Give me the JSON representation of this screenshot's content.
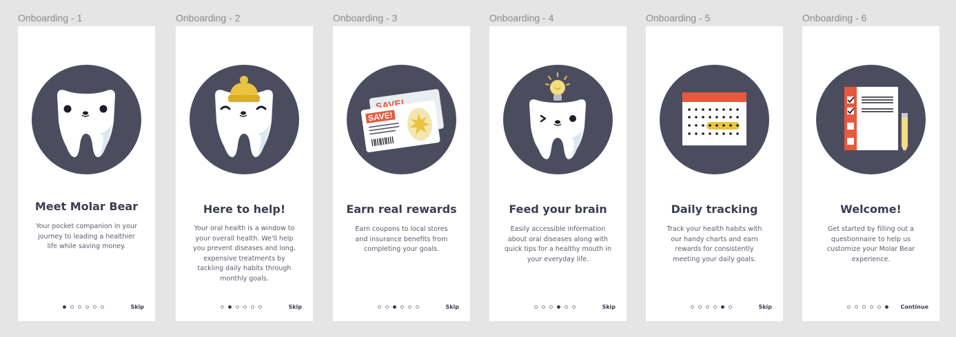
{
  "screens": [
    {
      "frame_label": "Onboarding - 1",
      "title": "Meet Molar Bear",
      "description": "Your pocket companion in your journey to leading a healthier life while saving money.",
      "active_dot": 1,
      "action_label": "Skip",
      "illustration": "molar-bear-icon"
    },
    {
      "frame_label": "Onboarding - 2",
      "title": "Here to help!",
      "description": "Your oral health is a window to your overall health. We'll help you prevent diseases and long, expensive treatments by tackling daily habits through monthly goals.",
      "active_dot": 2,
      "action_label": "Skip",
      "illustration": "molar-bear-beanie-icon"
    },
    {
      "frame_label": "Onboarding - 3",
      "title": "Earn real rewards",
      "description": "Earn coupons to local stores and insurance benefits from completing your goals.",
      "active_dot": 3,
      "action_label": "Skip",
      "illustration": "coupon-cards-icon",
      "coupon_text": "SAVE!"
    },
    {
      "frame_label": "Onboarding - 4",
      "title": "Feed your brain",
      "description": "Easily accessible information about oral diseases along with quick tips for a healthy mouth in your everyday life.",
      "active_dot": 4,
      "action_label": "Skip",
      "illustration": "molar-bear-lightbulb-icon"
    },
    {
      "frame_label": "Onboarding - 5",
      "title": "Daily tracking",
      "description": "Track your health habits with our handy charts and earn rewards for consistently meeting your daily goals.",
      "active_dot": 5,
      "action_label": "Skip",
      "illustration": "calendar-icon"
    },
    {
      "frame_label": "Onboarding - 6",
      "title": "Welcome!",
      "description": "Get started by filling out a questionnaire to help us customize your Molar Bear experience.",
      "active_dot": 6,
      "action_label": "Continue",
      "illustration": "checklist-pencil-icon"
    }
  ],
  "dot_count": 6,
  "colors": {
    "background": "#e5e5e5",
    "card": "#ffffff",
    "circle": "#4b4d5f",
    "title": "#3b3d4f",
    "body_text": "#5a5c6a",
    "accent_red": "#e8583c",
    "accent_yellow": "#e9c341"
  }
}
